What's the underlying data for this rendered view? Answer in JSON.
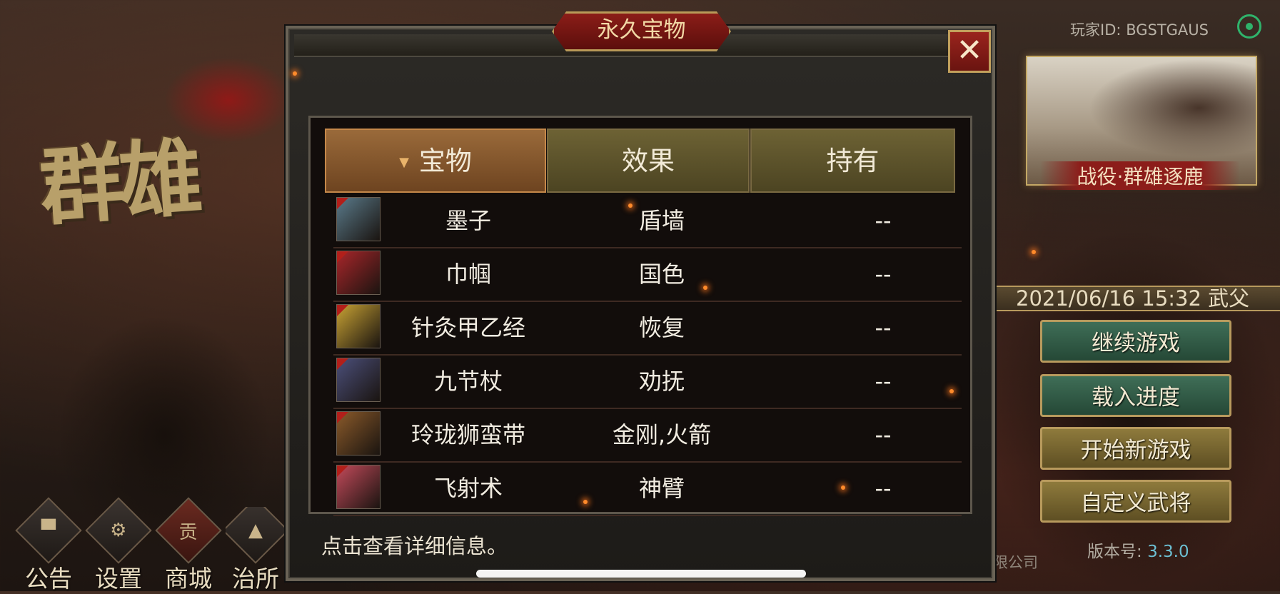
{
  "background": {
    "logo_text": "群雄",
    "player_id_label": "玩家ID:",
    "player_id": "BGSTGAUS",
    "campaign_title": "战役·群雄逐鹿",
    "save_info": "2021/06/16 15:32 武父",
    "menu": {
      "continue": "继续游戏",
      "load": "载入进度",
      "new_game": "开始新游戏",
      "custom_general": "自定义武将"
    },
    "version_label": "版本号:",
    "version": "3.3.0",
    "company_fragment": "有限公司",
    "nav": [
      {
        "label": "公告",
        "glyph": "▀"
      },
      {
        "label": "设置",
        "glyph": "⚙"
      },
      {
        "label": "商城",
        "glyph": "贡"
      },
      {
        "label": "治所",
        "glyph": "▲"
      }
    ]
  },
  "modal": {
    "title": "永久宝物",
    "close_glyph": "✕",
    "columns": {
      "treasure": "宝物",
      "effect": "效果",
      "owned": "持有"
    },
    "rows": [
      {
        "name": "墨子",
        "effect": "盾墙",
        "owned": "--",
        "icon": "scroll-icon",
        "color": "#5a7a8a"
      },
      {
        "name": "巾帼",
        "effect": "国色",
        "owned": "--",
        "icon": "robe-icon",
        "color": "#a8262a"
      },
      {
        "name": "针灸甲乙经",
        "effect": "恢复",
        "owned": "--",
        "icon": "book-icon",
        "color": "#c8a234"
      },
      {
        "name": "九节杖",
        "effect": "劝抚",
        "owned": "--",
        "icon": "staff-icon",
        "color": "#4b4f7a"
      },
      {
        "name": "玲珑狮蛮带",
        "effect": "金刚,火箭",
        "owned": "--",
        "icon": "belt-icon",
        "color": "#8a5a2a"
      },
      {
        "name": "飞射术",
        "effect": "神臂",
        "owned": "--",
        "icon": "manual-icon",
        "color": "#c24a5a"
      }
    ],
    "footer_hint": "点击查看详细信息。"
  },
  "colors": {
    "accent_gold": "#b89a5d",
    "title_red": "#8b1d18",
    "version_blue": "#6cbfd2"
  }
}
